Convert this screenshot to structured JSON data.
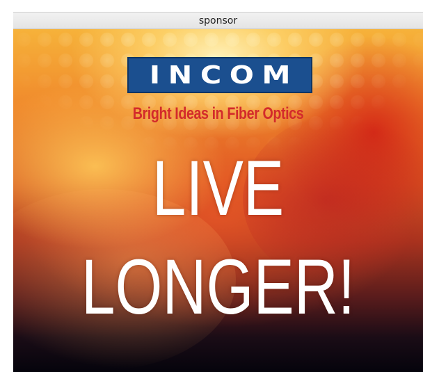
{
  "header": {
    "label": "sponsor"
  },
  "ad": {
    "logo_text": "INCOM",
    "tagline": "Bright Ideas in Fiber Optics",
    "headline_line1": "LIVE",
    "headline_line2": "LONGER!",
    "colors": {
      "logo_background": "#1b4f8f",
      "tagline": "#d32b2b",
      "headline": "#ffffff"
    }
  }
}
